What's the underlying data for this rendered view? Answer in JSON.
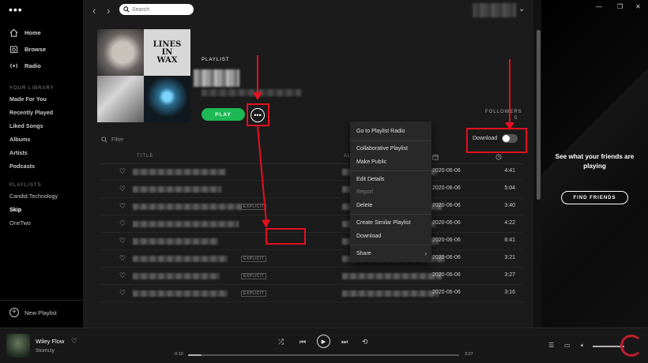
{
  "sidebar": {
    "menu_dots": "•••",
    "nav": [
      {
        "label": "Home",
        "icon": "home-icon"
      },
      {
        "label": "Browse",
        "icon": "browse-icon"
      },
      {
        "label": "Radio",
        "icon": "radio-icon"
      }
    ],
    "library_heading": "YOUR LIBRARY",
    "library": [
      "Made For You",
      "Recently Played",
      "Liked Songs",
      "Albums",
      "Artists",
      "Podcasts"
    ],
    "playlists_heading": "PLAYLISTS",
    "playlists": [
      "Candid.Technology",
      "Skip",
      "OneTwo"
    ],
    "active_playlist": "Skip",
    "new_playlist": "New Playlist"
  },
  "topbar": {
    "search_placeholder": "Search",
    "back": "‹",
    "forward": "›"
  },
  "playlist": {
    "cover_tile_text": "LINES IN WAX",
    "type_label": "PLAYLIST",
    "play_label": "PLAY",
    "more_label": "•••",
    "followers_label": "FOLLOWERS",
    "followers_count": "0",
    "filter_placeholder": "Filter",
    "download_label": "Download",
    "download_on": false
  },
  "table": {
    "columns": {
      "title": "TITLE",
      "album": "ALBUM"
    },
    "rows": [
      {
        "date": "2020-06-06",
        "duration": "4:41",
        "explicit": false
      },
      {
        "date": "2020-06-06",
        "duration": "5:04",
        "explicit": false
      },
      {
        "date": "2020-06-06",
        "duration": "3:40",
        "explicit": true
      },
      {
        "date": "2020-06-06",
        "duration": "4:22",
        "explicit": false
      },
      {
        "date": "2020-06-06",
        "duration": "8:41",
        "explicit": false
      },
      {
        "date": "2020-06-06",
        "duration": "3:21",
        "explicit": true
      },
      {
        "date": "2020-06-06",
        "duration": "3:27",
        "explicit": true
      },
      {
        "date": "2020-06-06",
        "duration": "3:16",
        "explicit": true
      }
    ],
    "explicit_label": "EXPLICIT"
  },
  "context_menu": {
    "items": [
      {
        "label": "Go to Playlist Radio",
        "disabled": false
      },
      {
        "label": "Collaborative Playlist",
        "disabled": false
      },
      {
        "label": "Make Public",
        "disabled": false
      },
      {
        "label": "Edit Details",
        "disabled": false
      },
      {
        "label": "Report",
        "disabled": true
      },
      {
        "label": "Delete",
        "disabled": false
      },
      {
        "label": "Create Similar Playlist",
        "disabled": false
      },
      {
        "label": "Download",
        "disabled": false
      },
      {
        "label": "Share",
        "disabled": false
      }
    ]
  },
  "friends_panel": {
    "message": "See what your friends are playing",
    "button": "FIND FRIENDS"
  },
  "player": {
    "track": "Wiley Flow",
    "artist": "Stormzy",
    "elapsed": "0:10",
    "total": "3:27",
    "progress": 0.05
  },
  "colors": {
    "accent": "#1db954",
    "annotation": "#e3101f"
  }
}
